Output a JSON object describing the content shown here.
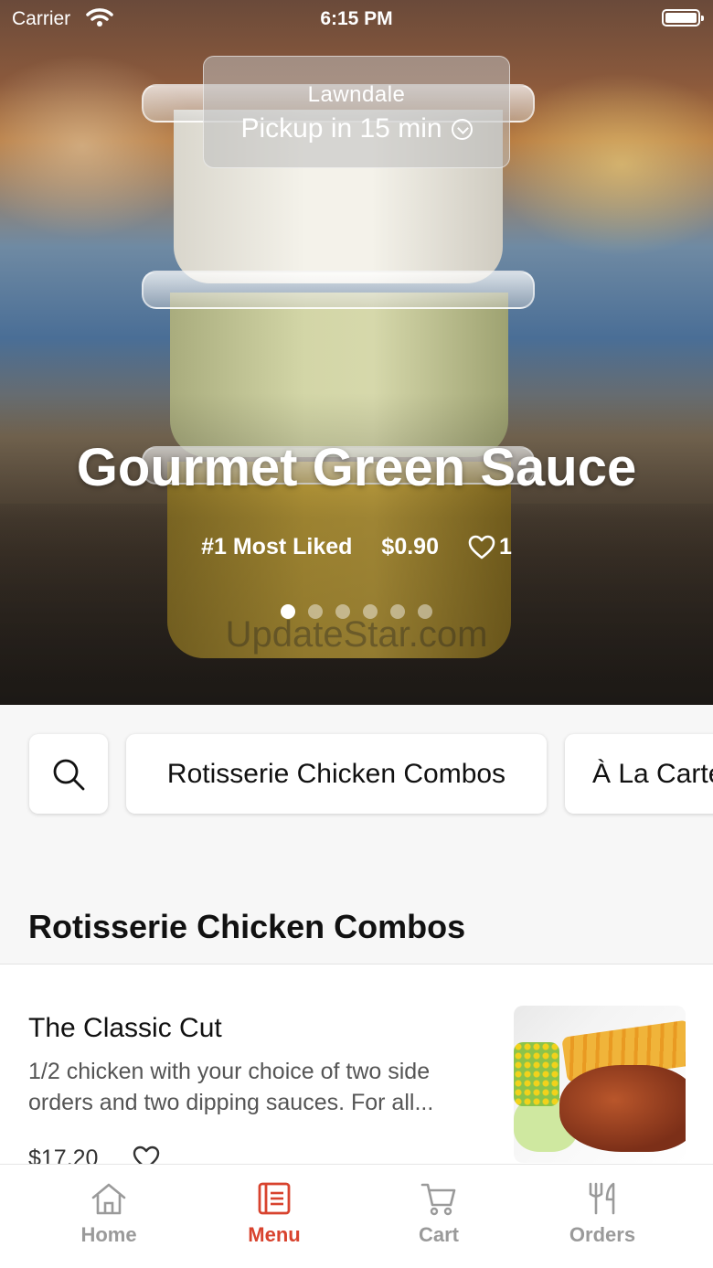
{
  "status_bar": {
    "carrier": "Carrier",
    "time": "6:15 PM"
  },
  "pickup": {
    "location": "Lawndale",
    "eta": "Pickup in 15 min"
  },
  "hero": {
    "title": "Gourmet Green Sauce",
    "rank": "#1 Most Liked",
    "price": "$0.90",
    "likes": "1",
    "carousel_pages": 6,
    "carousel_active_index": 0,
    "watermark": "UpdateStar.com"
  },
  "categories": [
    "Rotisserie Chicken Combos",
    "À La Carte"
  ],
  "section": {
    "title": "Rotisserie Chicken Combos"
  },
  "items": [
    {
      "name": "The Classic Cut",
      "description": "1/2 chicken with your choice of two side orders and two dipping sauces. For all...",
      "price": "$17.20"
    }
  ],
  "tabbar": {
    "home": "Home",
    "menu": "Menu",
    "cart": "Cart",
    "orders": "Orders",
    "active": "Menu",
    "active_color": "#d8432e",
    "inactive_color": "#9a9a9a"
  }
}
